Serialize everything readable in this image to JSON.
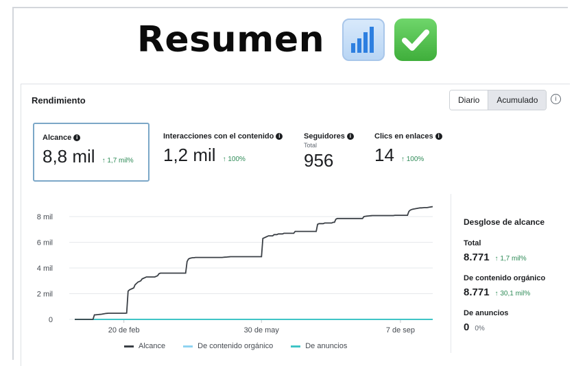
{
  "header": {
    "title": "Resumen",
    "icons": [
      "bar-chart-emoji",
      "check-mark-emoji"
    ]
  },
  "card": {
    "title": "Rendimiento",
    "toggle": {
      "options": [
        "Diario",
        "Acumulado"
      ],
      "selected": "Acumulado"
    }
  },
  "metrics": [
    {
      "label": "Alcance",
      "value": "8,8 mil",
      "change": "↑ 1,7 mil%",
      "sub": ""
    },
    {
      "label": "Interacciones con el contenido",
      "value": "1,2 mil",
      "change": "↑ 100%",
      "sub": ""
    },
    {
      "label": "Seguidores",
      "value": "956",
      "change": "",
      "sub": "Total"
    },
    {
      "label": "Clics en enlaces",
      "value": "14",
      "change": "↑ 100%",
      "sub": ""
    }
  ],
  "breakdown": {
    "title": "Desglose de alcance",
    "items": [
      {
        "label": "Total",
        "value": "8.771",
        "change": "↑ 1,7 mil%"
      },
      {
        "label": "De contenido orgánico",
        "value": "8.771",
        "change": "↑ 30,1 mil%"
      },
      {
        "label": "De anuncios",
        "value": "0",
        "change": "0%"
      }
    ]
  },
  "legend": [
    "Alcance",
    "De contenido orgánico",
    "De anuncios"
  ],
  "colors": {
    "alcance": "#3a3f45",
    "organico": "#8fd3f0",
    "anuncios": "#3fc4c6",
    "positive": "#2e8b57",
    "selected_border": "#7ba7c7"
  },
  "chart_data": {
    "type": "line",
    "x_ticks": [
      "20 de feb",
      "30 de may",
      "7 de sep"
    ],
    "y_ticks": [
      "0",
      "2 mil",
      "4 mil",
      "6 mil",
      "8 mil"
    ],
    "ylim": [
      0,
      8800
    ],
    "x_tick_index": [
      35,
      133,
      232
    ],
    "series": [
      {
        "name": "Alcance",
        "values": [
          0,
          0,
          0,
          0,
          0,
          0,
          0,
          0,
          0,
          0,
          0,
          0,
          0,
          0,
          350,
          360,
          370,
          380,
          390,
          400,
          420,
          440,
          460,
          470,
          480,
          480,
          480,
          480,
          480,
          480,
          480,
          480,
          480,
          480,
          480,
          480,
          480,
          490,
          2200,
          2300,
          2350,
          2400,
          2450,
          2700,
          2800,
          2900,
          2950,
          3000,
          3150,
          3200,
          3250,
          3300,
          3300,
          3300,
          3300,
          3300,
          3300,
          3300,
          3350,
          3400,
          3550,
          3600,
          3600,
          3600,
          3600,
          3600,
          3600,
          3600,
          3600,
          3600,
          3600,
          3600,
          3600,
          3600,
          3600,
          3600,
          3600,
          3600,
          3600,
          3600,
          4500,
          4700,
          4750,
          4780,
          4800,
          4800,
          4820,
          4820,
          4820,
          4820,
          4820,
          4820,
          4820,
          4820,
          4820,
          4820,
          4820,
          4820,
          4820,
          4820,
          4820,
          4820,
          4820,
          4820,
          4820,
          4820,
          4830,
          4840,
          4850,
          4860,
          4870,
          4880,
          4880,
          4880,
          4880,
          4880,
          4880,
          4880,
          4880,
          4880,
          4880,
          4880,
          4880,
          4880,
          4880,
          4880,
          4880,
          4880,
          4880,
          4880,
          4880,
          4880,
          4880,
          4880,
          6300,
          6350,
          6400,
          6450,
          6500,
          6500,
          6500,
          6500,
          6600,
          6600,
          6600,
          6650,
          6650,
          6650,
          6650,
          6700,
          6700,
          6700,
          6700,
          6700,
          6700,
          6700,
          6700,
          6850,
          6850,
          6850,
          6850,
          6850,
          6850,
          6850,
          6850,
          6850,
          6850,
          6850,
          6850,
          6850,
          6850,
          6850,
          6850,
          7400,
          7450,
          7450,
          7450,
          7450,
          7500,
          7500,
          7500,
          7500,
          7500,
          7500,
          7550,
          7550,
          7800,
          7850,
          7850,
          7850,
          7850,
          7850,
          7850,
          7850,
          7850,
          7850,
          7850,
          7850,
          7850,
          7850,
          7850,
          7850,
          7850,
          7850,
          7850,
          7850,
          8000,
          8020,
          8040,
          8050,
          8060,
          8070,
          8080,
          8080,
          8080,
          8080,
          8080,
          8080,
          8080,
          8080,
          8080,
          8080,
          8080,
          8080,
          8080,
          8080,
          8080,
          8080,
          8100,
          8100,
          8100,
          8100,
          8100,
          8100,
          8100,
          8100,
          8100,
          8100,
          8400,
          8500,
          8550,
          8580,
          8600,
          8620,
          8640,
          8660,
          8680,
          8680,
          8690,
          8700,
          8700,
          8700,
          8720,
          8740,
          8760,
          8771
        ]
      },
      {
        "name": "De contenido orgánico",
        "values": []
      },
      {
        "name": "De anuncios",
        "values": []
      }
    ]
  }
}
